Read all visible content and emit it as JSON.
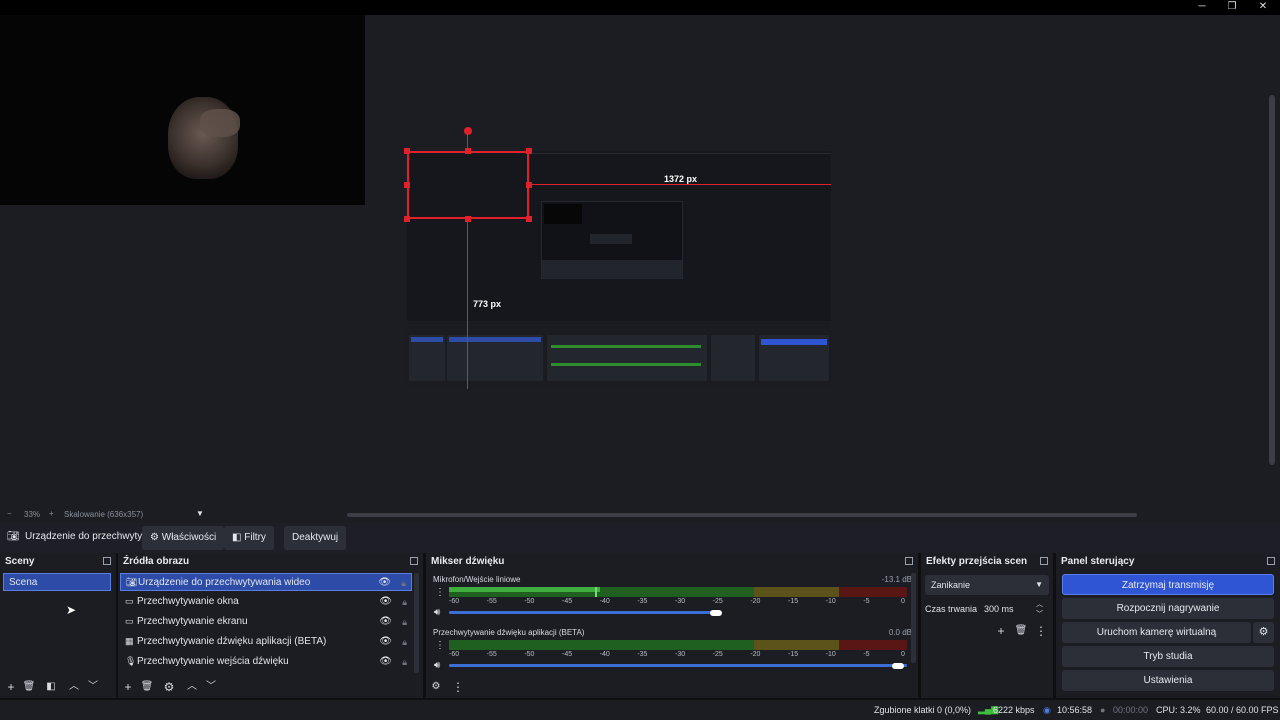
{
  "window": {
    "minimize": "─",
    "maximize": "❐",
    "close": "✕"
  },
  "preview": {
    "width_label": "1372 px",
    "height_label": "773 px"
  },
  "zoom_bar": {
    "minus": "−",
    "zoom": "33%",
    "plus": "+",
    "scaling": "Skalowanie (636x357)",
    "dropdown": "▼"
  },
  "source_toolbar": {
    "source_name": "Urządzenie do przechwyty",
    "properties": "Właściwości",
    "filters": "Filtry",
    "deactivate": "Deaktywuj"
  },
  "scenes": {
    "title": "Sceny",
    "items": [
      "Scena"
    ]
  },
  "sources": {
    "title": "Źródła obrazu",
    "items": [
      {
        "label": "Urządzenie do przechwytywania wideo",
        "icon": "camera-icon"
      },
      {
        "label": "Przechwytywanie okna",
        "icon": "window-icon"
      },
      {
        "label": "Przechwytywanie ekranu",
        "icon": "monitor-icon"
      },
      {
        "label": "Przechwytywanie dźwięku aplikacji (BETA)",
        "icon": "app-audio-icon"
      },
      {
        "label": "Przechwytywanie wejścia dźwięku",
        "icon": "microphone-icon"
      }
    ]
  },
  "mixer": {
    "title": "Mikser dźwięku",
    "ticks": [
      "-60",
      "-55",
      "-50",
      "-45",
      "-40",
      "-35",
      "-30",
      "-25",
      "-20",
      "-15",
      "-10",
      "-5",
      "0"
    ],
    "channels": [
      {
        "name": "Mikrofon/Wejście liniowe",
        "db": "-13.1 dB",
        "level": 0.33
      },
      {
        "name": "Przechwytywanie dźwięku aplikacji (BETA)",
        "db": "0.0 dB",
        "level": 1.0
      }
    ]
  },
  "transitions": {
    "title": "Efekty przejścia scen",
    "selected": "Zanikanie",
    "duration_label": "Czas trwania",
    "duration_value": "300 ms"
  },
  "controls": {
    "title": "Panel sterujący",
    "stop_stream": "Zatrzymaj transmisję",
    "start_recording": "Rozpocznij nagrywanie",
    "virtual_camera": "Uruchom kamerę wirtualną",
    "studio_mode": "Tryb studia",
    "settings": "Ustawienia"
  },
  "status": {
    "dropped_frames": "Zgubione klatki 0 (0,0%)",
    "bitrate": "6222 kbps",
    "stream_time": "10:56:58",
    "rec_time": "00:00:00",
    "cpu": "CPU: 3.2%",
    "fps": "60.00 / 60.00 FPS"
  },
  "colors": {
    "accent": "#2f55d4",
    "selection_red": "#e0212b",
    "meter_green": "#2e8b2e",
    "meter_yellow": "#8a7a22",
    "meter_red": "#7a1a1a"
  }
}
